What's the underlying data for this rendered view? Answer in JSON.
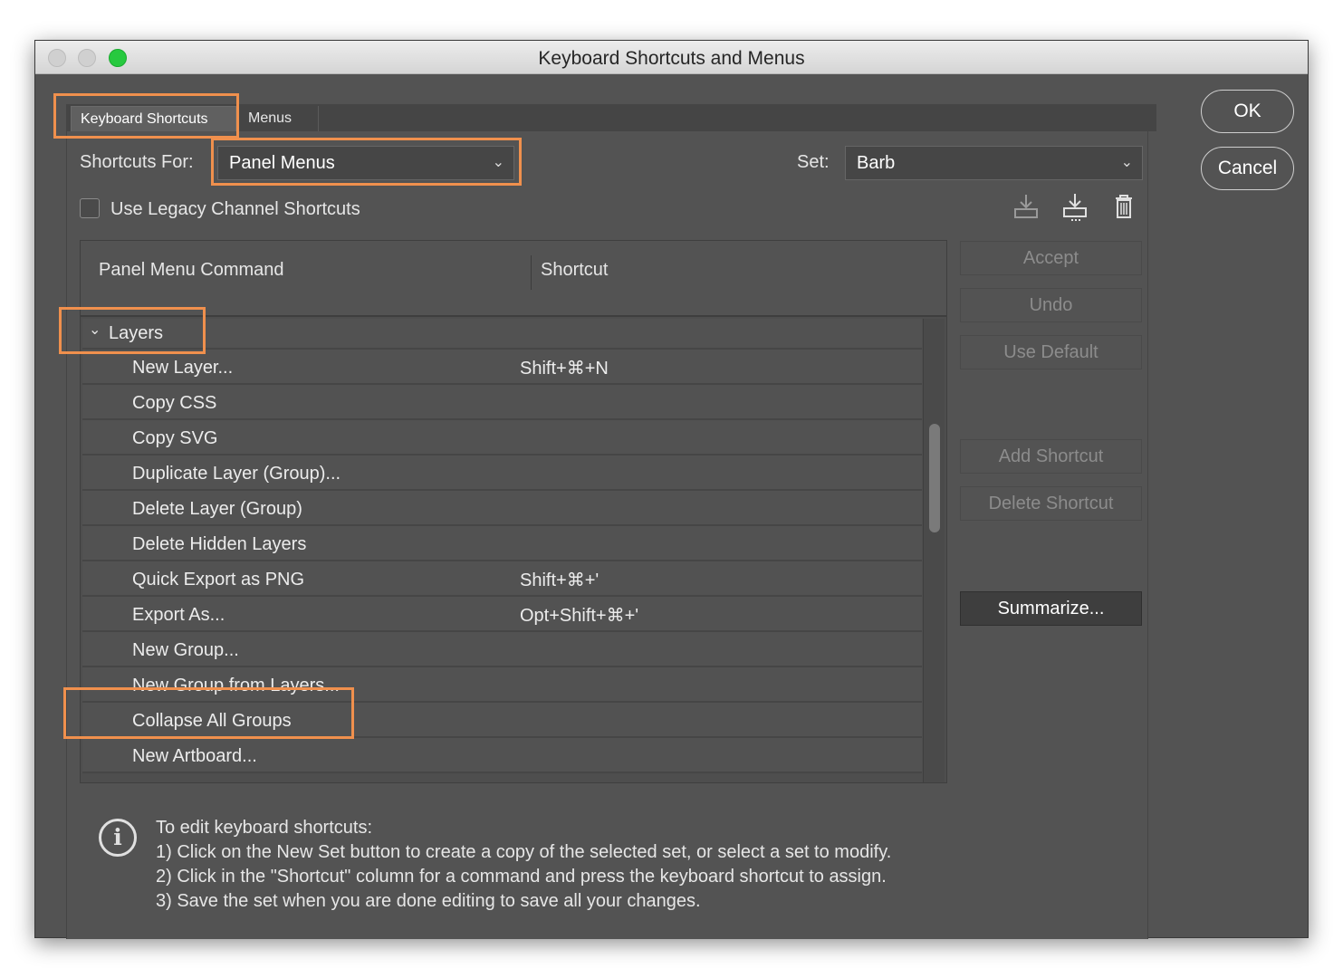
{
  "window": {
    "title": "Keyboard Shortcuts and Menus"
  },
  "tabs": [
    {
      "label": "Keyboard Shortcuts",
      "active": true
    },
    {
      "label": "Menus",
      "active": false
    }
  ],
  "shortcuts_for": {
    "label": "Shortcuts For:",
    "value": "Panel Menus"
  },
  "set": {
    "label": "Set:",
    "value": "Barb"
  },
  "legacy": {
    "label": "Use Legacy Channel Shortcuts",
    "checked": false
  },
  "toolbar_icons": [
    "save-set-icon",
    "new-set-icon",
    "trash-icon"
  ],
  "table": {
    "headers": {
      "command": "Panel Menu Command",
      "shortcut": "Shortcut"
    },
    "group": {
      "label": "Layers",
      "expanded": true
    },
    "rows": [
      {
        "command": "New Layer...",
        "shortcut": "Shift+⌘+N"
      },
      {
        "command": "Copy CSS",
        "shortcut": ""
      },
      {
        "command": "Copy SVG",
        "shortcut": ""
      },
      {
        "command": "Duplicate Layer (Group)...",
        "shortcut": ""
      },
      {
        "command": "Delete Layer (Group)",
        "shortcut": ""
      },
      {
        "command": "Delete Hidden Layers",
        "shortcut": ""
      },
      {
        "command": "Quick Export as PNG",
        "shortcut": "Shift+⌘+'"
      },
      {
        "command": "Export As...",
        "shortcut": "Opt+Shift+⌘+'"
      },
      {
        "command": "New Group...",
        "shortcut": ""
      },
      {
        "command": "New Group from Layers...",
        "shortcut": ""
      },
      {
        "command": "Collapse All Groups",
        "shortcut": ""
      },
      {
        "command": "New Artboard...",
        "shortcut": ""
      }
    ]
  },
  "side_buttons": {
    "accept": "Accept",
    "undo": "Undo",
    "use_default": "Use Default",
    "add_shortcut": "Add Shortcut",
    "delete_shortcut": "Delete Shortcut",
    "summarize": "Summarize..."
  },
  "dialog_buttons": {
    "ok": "OK",
    "cancel": "Cancel"
  },
  "help": {
    "icon": "info-icon",
    "title": "To edit keyboard shortcuts:",
    "steps": [
      "1) Click on the New Set button to create a copy of the selected set, or select a set to modify.",
      "2) Click in the \"Shortcut\" column for a command and press the keyboard shortcut to assign.",
      "3) Save the set when you are done editing to save all your changes."
    ]
  },
  "colors": {
    "highlight": "#f0904d",
    "dialog_bg": "#535353",
    "traffic_green": "#27c93f"
  }
}
